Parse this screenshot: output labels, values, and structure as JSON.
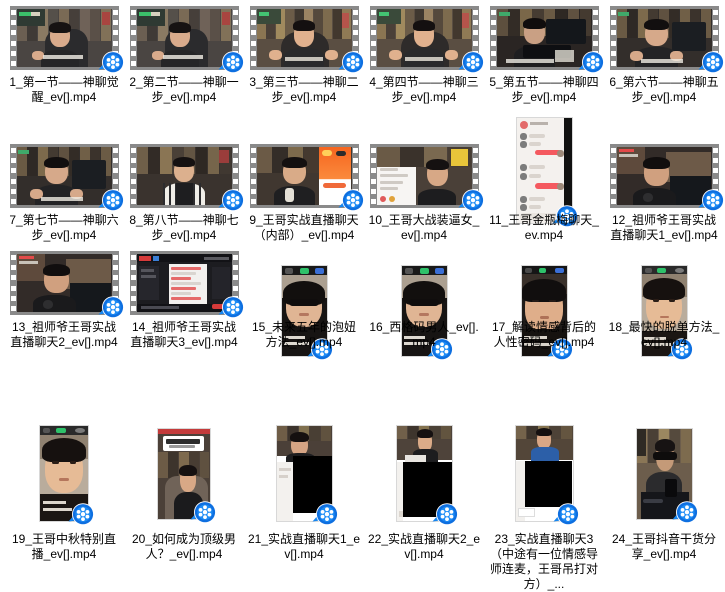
{
  "view": {
    "kind": "file-explorer-thumbnail-grid",
    "background": "#ffffff",
    "columns": 6,
    "rows": 4,
    "badge_icon": "video-file-player-badge-icon",
    "badge_color": "#0a6fe8",
    "filmstrip_color": "#8a8a8a",
    "text_color": "#000000"
  },
  "files": [
    {
      "index": 1,
      "name": "1_第一节——神聊觉醒_ev[].mp4",
      "thumb": "filmstrip",
      "art": "man-bookshelf-gray",
      "icon": "video-file-icon"
    },
    {
      "index": 2,
      "name": "2_第二节——神聊一步_ev[].mp4",
      "thumb": "filmstrip",
      "art": "man-bookshelf-gray",
      "icon": "video-file-icon"
    },
    {
      "index": 3,
      "name": "3_第三节——神聊二步_ev[].mp4",
      "thumb": "filmstrip",
      "art": "man-bookshelf-warm",
      "icon": "video-file-icon"
    },
    {
      "index": 4,
      "name": "4_第四节——神聊三步_ev[].mp4",
      "thumb": "filmstrip",
      "art": "man-bookshelf-warm",
      "icon": "video-file-icon"
    },
    {
      "index": 5,
      "name": "5_第五节——神聊四步_ev[].mp4",
      "thumb": "filmstrip",
      "art": "man-desk-dark",
      "icon": "video-file-icon"
    },
    {
      "index": 6,
      "name": "6_第六节——神聊五步_ev[].mp4",
      "thumb": "filmstrip",
      "art": "man-bookshelf-dark",
      "icon": "video-file-icon"
    },
    {
      "index": 7,
      "name": "7_第七节——神聊六步_ev[].mp4",
      "thumb": "filmstrip",
      "art": "man-bookshelf-dark",
      "icon": "video-file-icon"
    },
    {
      "index": 8,
      "name": "8_第八节——神聊七步_ev[].mp4",
      "thumb": "filmstrip",
      "art": "man-striped-dark",
      "icon": "video-file-icon"
    },
    {
      "index": 9,
      "name": "9_王哥实战直播聊天（内部）_ev[].mp4",
      "thumb": "filmstrip",
      "art": "man-with-orange-phone",
      "icon": "video-file-icon"
    },
    {
      "index": 10,
      "name": "10_王哥大战装逼女_ev[].mp4",
      "thumb": "filmstrip",
      "art": "man-with-chat-panel",
      "icon": "video-file-icon"
    },
    {
      "index": 11,
      "name": "11_王哥金瓶梅聊天_ev.mp4",
      "thumb": "portrait",
      "art": "chat-screenshot-light",
      "icon": "video-file-icon"
    },
    {
      "index": 12,
      "name": "12_祖师爷王哥实战直播聊天1_ev[].mp4",
      "thumb": "filmstrip",
      "art": "man-at-laptop",
      "icon": "video-file-icon"
    },
    {
      "index": 13,
      "name": "13_祖师爷王哥实战直播聊天2_ev[].mp4",
      "thumb": "filmstrip",
      "art": "man-at-laptop",
      "icon": "video-file-icon"
    },
    {
      "index": 14,
      "name": "14_祖师爷王哥实战直播聊天3_ev[].mp4",
      "thumb": "filmstrip",
      "art": "dark-stream-ui",
      "icon": "video-file-icon"
    },
    {
      "index": 15,
      "name": "15_未来五年的泡妞方法_ev[].mp4",
      "thumb": "portrait",
      "art": "man-sunglasses-vertical",
      "icon": "video-file-icon"
    },
    {
      "index": 16,
      "name": "16_西格码男人_ev[].mp4",
      "thumb": "portrait",
      "art": "man-sunglasses-vertical",
      "icon": "video-file-icon"
    },
    {
      "index": 17,
      "name": "17_解读情感背后的人性密码_ev[].mp4",
      "thumb": "portrait",
      "art": "man-closeup-vertical",
      "icon": "video-file-icon"
    },
    {
      "index": 18,
      "name": "18_最快的脱单方法_ev[].mp4",
      "thumb": "portrait",
      "art": "man-closeup-vertical-light",
      "icon": "video-file-icon"
    },
    {
      "index": 19,
      "name": "19_王哥中秋特别直播_ev[].mp4",
      "thumb": "portrait",
      "art": "man-closeup-vertical-light",
      "icon": "video-file-icon"
    },
    {
      "index": 20,
      "name": "20_如何成为顶级男人？_ev[].mp4",
      "thumb": "portrait",
      "art": "man-sofa-banner",
      "icon": "video-file-icon"
    },
    {
      "index": 21,
      "name": "21_实战直播聊天1_ev[].mp4",
      "thumb": "portrait",
      "art": "man-top-black-bottom",
      "icon": "video-file-icon"
    },
    {
      "index": 22,
      "name": "22_实战直播聊天2_ev[].mp4",
      "thumb": "portrait",
      "art": "man-tank-top-black-bottom",
      "icon": "video-file-icon"
    },
    {
      "index": 23,
      "name": "23_实战直播聊天3（中途有一位情感导师连麦，王哥吊打对方）_...",
      "thumb": "portrait",
      "art": "man-blue-top-black-bottom",
      "icon": "video-file-icon"
    },
    {
      "index": 24,
      "name": "24_王哥抖音干货分享_ev[].mp4",
      "thumb": "portrait",
      "art": "man-sunglasses-laptop",
      "icon": "video-file-icon"
    }
  ]
}
